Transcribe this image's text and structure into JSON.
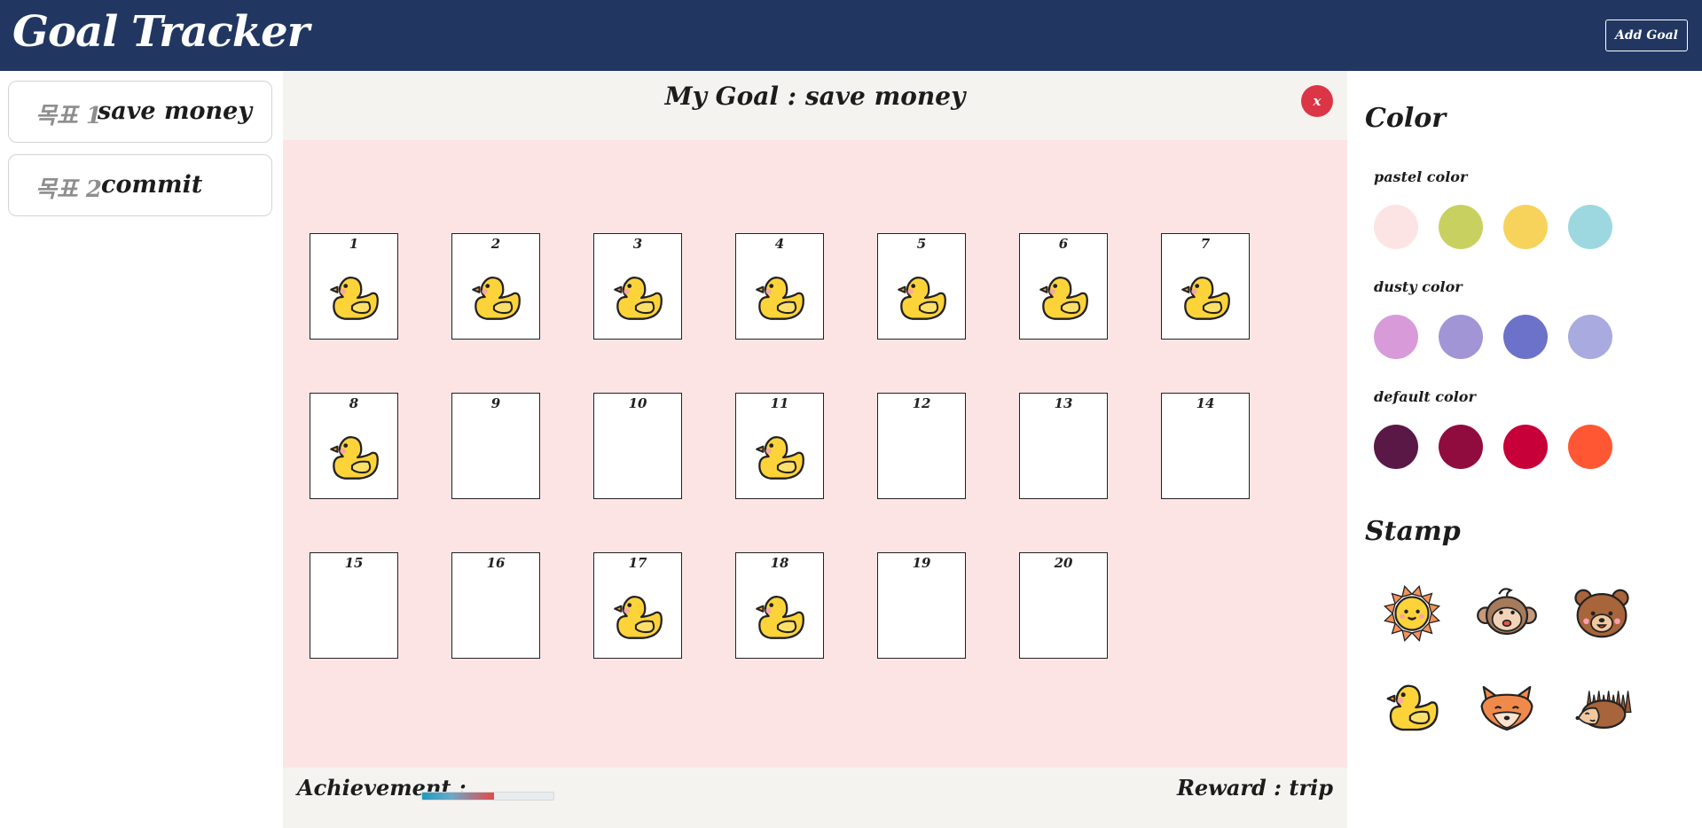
{
  "app": {
    "title": "Goal Tracker",
    "add_goal_label": "Add Goal"
  },
  "sidebar": {
    "goals": [
      {
        "label": "목표 1",
        "name": "save money"
      },
      {
        "label": "목표 2",
        "name": "commit"
      }
    ]
  },
  "main": {
    "goal_title": "My Goal : save money",
    "close_label": "x",
    "cells": [
      {
        "number": "1",
        "stamped": true
      },
      {
        "number": "2",
        "stamped": true
      },
      {
        "number": "3",
        "stamped": true
      },
      {
        "number": "4",
        "stamped": true
      },
      {
        "number": "5",
        "stamped": true
      },
      {
        "number": "6",
        "stamped": true
      },
      {
        "number": "7",
        "stamped": true
      },
      {
        "number": "8",
        "stamped": true
      },
      {
        "number": "9",
        "stamped": false
      },
      {
        "number": "10",
        "stamped": false
      },
      {
        "number": "11",
        "stamped": true
      },
      {
        "number": "12",
        "stamped": false
      },
      {
        "number": "13",
        "stamped": false
      },
      {
        "number": "14",
        "stamped": false
      },
      {
        "number": "15",
        "stamped": false
      },
      {
        "number": "16",
        "stamped": false
      },
      {
        "number": "17",
        "stamped": true
      },
      {
        "number": "18",
        "stamped": true
      },
      {
        "number": "19",
        "stamped": false
      },
      {
        "number": "20",
        "stamped": false
      }
    ],
    "achievement_label": "Achievement :",
    "achievement_percent": 55,
    "reward_label": "Reward : trip",
    "board_color": "#fde4e4"
  },
  "panel": {
    "color_title": "Color",
    "pastel_label": "pastel color",
    "pastel_colors": [
      "#fde4e4",
      "#c8d15f",
      "#f7d35c",
      "#9dd8e0"
    ],
    "dusty_label": "dusty color",
    "dusty_colors": [
      "#d89ad9",
      "#a295d6",
      "#6c71c9",
      "#a8aae0"
    ],
    "default_label": "default color",
    "default_colors": [
      "#5a1846",
      "#900c3f",
      "#c70039",
      "#ff5733"
    ],
    "stamp_title": "Stamp",
    "stamps": [
      "sun-icon",
      "monkey-icon",
      "bear-icon",
      "duck-icon",
      "fox-icon",
      "hedgehog-icon"
    ]
  }
}
